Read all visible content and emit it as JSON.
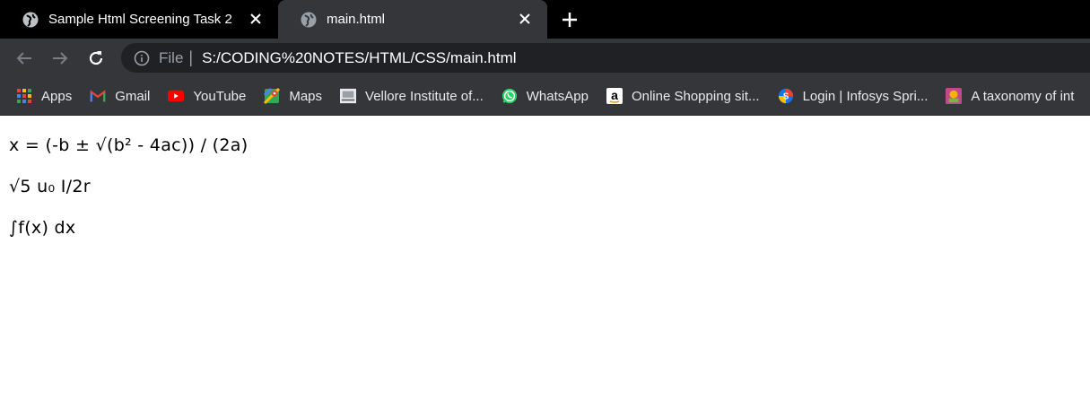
{
  "tabs": [
    {
      "title": "Sample Html Screening Task 2",
      "active": false
    },
    {
      "title": "main.html",
      "active": true
    }
  ],
  "omnibox": {
    "scheme": "File",
    "separator": "|",
    "url": "S:/CODING%20NOTES/HTML/CSS/main.html"
  },
  "bookmarks": [
    {
      "label": "Apps",
      "icon": "apps-grid-icon"
    },
    {
      "label": "Gmail",
      "icon": "gmail-icon"
    },
    {
      "label": "YouTube",
      "icon": "youtube-icon"
    },
    {
      "label": "Maps",
      "icon": "maps-icon"
    },
    {
      "label": "Vellore Institute of...",
      "icon": "vit-logo-icon"
    },
    {
      "label": "WhatsApp",
      "icon": "whatsapp-icon"
    },
    {
      "label": "Online Shopping sit...",
      "icon": "amazon-icon"
    },
    {
      "label": "Login | Infosys Spri...",
      "icon": "infosys-springboard-icon"
    },
    {
      "label": "A taxonomy of int",
      "icon": "taxonomy-site-icon"
    }
  ],
  "page": {
    "lines": [
      "x = (-b ± √(b² - 4ac)) / (2a)",
      "√5 u₀ I/2r",
      "∫f(x) dx"
    ]
  },
  "colors": {
    "tabstrip_bg": "#000000",
    "active_tab_bg": "#35363a",
    "toolbar_bg": "#35363a",
    "omnibox_bg": "#202124",
    "page_bg": "#ffffff"
  }
}
